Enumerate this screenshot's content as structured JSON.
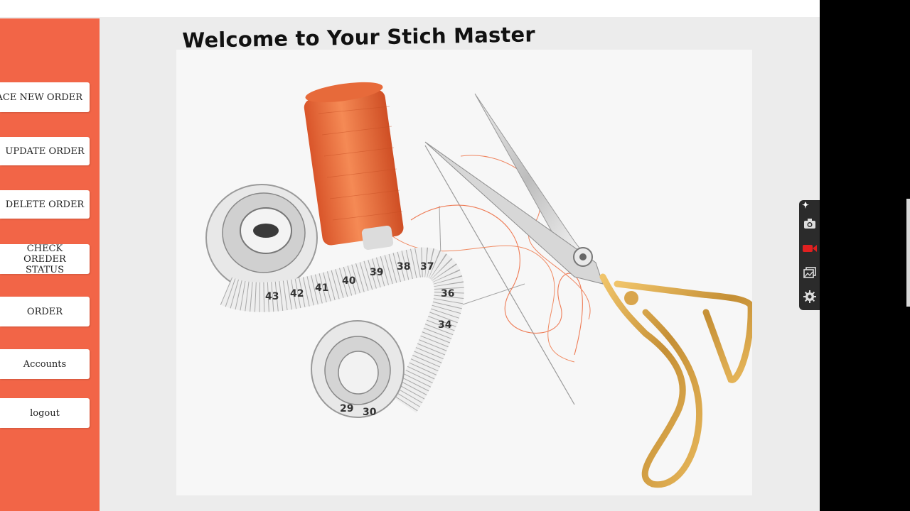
{
  "title": "Welcome to Your Stich Master",
  "sidebar": {
    "items": [
      {
        "label": "PLACE NEW ORDER"
      },
      {
        "label": "UPDATE ORDER"
      },
      {
        "label": "DELETE ORDER"
      },
      {
        "label": "CHECK OREDER STATUS"
      },
      {
        "label": "ORDER"
      },
      {
        "label": "Accounts"
      },
      {
        "label": "logout"
      }
    ]
  },
  "hero_image": {
    "icon": "sewing-supplies-image"
  },
  "tape_numbers": [
    "29",
    "30",
    "34",
    "36",
    "37",
    "38",
    "39",
    "40",
    "41",
    "42",
    "43"
  ],
  "recorder": {
    "icons": [
      "pin-icon",
      "camera-icon",
      "video-record-icon",
      "gallery-icon",
      "settings-gear-icon"
    ]
  },
  "colors": {
    "sidebar": "#f26547",
    "background": "#ececec",
    "button": "#ffffff",
    "spool": "#f0733f",
    "scissors_handle": "#d4a24c",
    "record_red": "#e02020"
  }
}
